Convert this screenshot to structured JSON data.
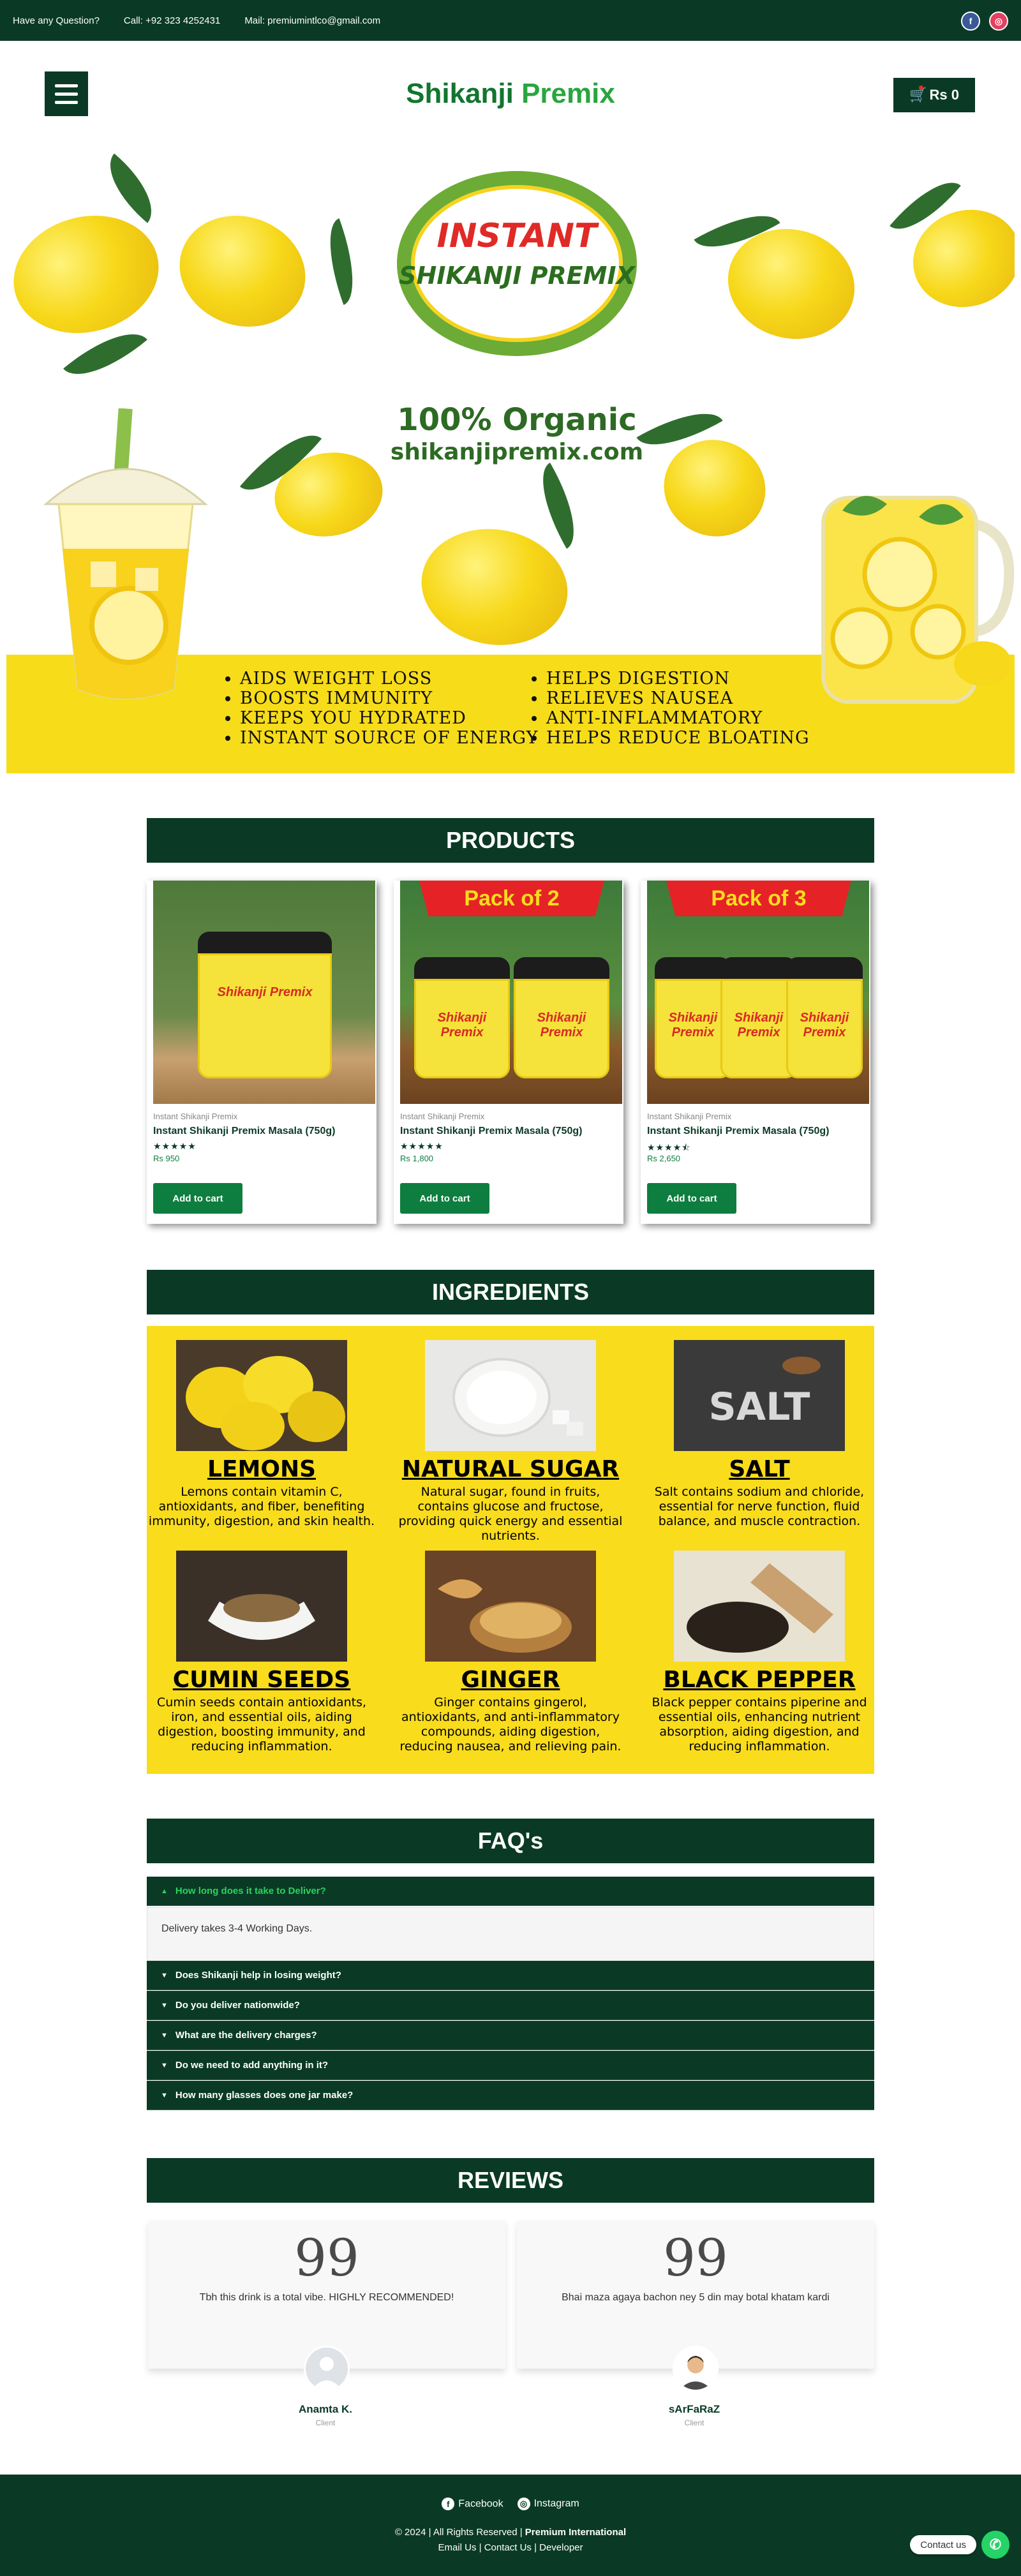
{
  "topbar": {
    "question": "Have any Question?",
    "call": "Call: +92 323 4252431",
    "mail": "Mail:   premiumintlco@gmail.com",
    "facebook_glyph": "f",
    "instagram_glyph": "◎"
  },
  "header": {
    "brand_part1": "Shikanji",
    "brand_part2": " Premix",
    "cart_label": "Rs 0",
    "cart_icon": "🛒"
  },
  "hero": {
    "wreath_line1": "INSTANT",
    "wreath_line2": "SHIKANJI PREMIX",
    "organic": "100% Organic",
    "site": "shikanjipremix.com",
    "benefits_left": [
      "AIDS WEIGHT LOSS",
      "BOOSTS IMMUNITY",
      "KEEPS YOU HYDRATED",
      "INSTANT SOURCE OF ENERGY"
    ],
    "benefits_right": [
      "HELPS DIGESTION",
      "RELIEVES NAUSEA",
      "ANTI-INFLAMMATORY",
      "HELPS REDUCE BLOATING"
    ]
  },
  "products": {
    "heading": "PRODUCTS",
    "items": [
      {
        "category": "Instant Shikanji Premix",
        "title": "Instant Shikanji Premix Masala (750g)",
        "rating": 5,
        "stars": "★★★★★",
        "price": "Rs 950",
        "button": "Add to cart",
        "ribbon": "",
        "jar_label": "Shikanji Premix"
      },
      {
        "category": "Instant Shikanji Premix",
        "title": "Instant Shikanji Premix Masala (750g)",
        "rating": 5,
        "stars": "★★★★★",
        "price": "Rs 1,800",
        "button": "Add to cart",
        "ribbon": "Pack of 2",
        "jar_label": "Shikanji Premix"
      },
      {
        "category": "Instant Shikanji Premix",
        "title": "Instant Shikanji Premix Masala (750g)",
        "rating": 4.5,
        "stars": "★★★★⯪",
        "price": "Rs 2,650",
        "button": "Add to cart",
        "ribbon": "Pack of 3",
        "jar_label": "Shikanji Premix"
      }
    ]
  },
  "ingredients": {
    "heading": "INGREDIENTS",
    "items": [
      {
        "name": "LEMONS",
        "desc": "Lemons contain vitamin C, antioxidants, and fiber, benefiting immunity, digestion, and skin health."
      },
      {
        "name": "NATURAL SUGAR",
        "desc": "Natural sugar, found in fruits, contains glucose and fructose, providing quick energy and essential nutrients."
      },
      {
        "name": "SALT",
        "desc": "Salt contains sodium and chloride, essential for nerve function, fluid balance, and muscle contraction."
      },
      {
        "name": "CUMIN SEEDS",
        "desc": "Cumin seeds contain antioxidants, iron, and essential oils, aiding digestion, boosting immunity, and reducing inflammation."
      },
      {
        "name": "GINGER",
        "desc": "Ginger contains gingerol, antioxidants, and anti-inflammatory compounds, aiding digestion, reducing nausea, and relieving pain."
      },
      {
        "name": "BLACK PEPPER",
        "desc": "Black pepper contains piperine and essential oils, enhancing nutrient absorption, aiding digestion, and reducing inflammation."
      }
    ],
    "salt_pic_text": "SALT"
  },
  "faq": {
    "heading": "FAQ's",
    "items": [
      {
        "q": "How long does it take to Deliver?",
        "open": true,
        "a": "Delivery takes 3-4 Working Days."
      },
      {
        "q": "Does Shikanji help in losing weight?",
        "open": false
      },
      {
        "q": "Do you deliver nationwide?",
        "open": false
      },
      {
        "q": "What are the delivery charges?",
        "open": false
      },
      {
        "q": "Do we need to add anything in it?",
        "open": false
      },
      {
        "q": "How many glasses does one jar make?",
        "open": false
      }
    ],
    "arrow_open": "▲",
    "arrow_closed": "▼"
  },
  "reviews": {
    "heading": "REVIEWS",
    "quote_glyph": "99",
    "items": [
      {
        "text": "Tbh this drink is a total vibe. HIGHLY RECOMMENDED!",
        "name": "Anamta K.",
        "role": "Client"
      },
      {
        "text": "Bhai maza agaya bachon ney 5 din may botal khatam kardi",
        "name": "sArFaRaZ",
        "role": "Client"
      }
    ]
  },
  "footer": {
    "facebook": "Facebook",
    "instagram": "Instagram",
    "fb_glyph": "f",
    "ig_glyph": "◎",
    "copyright": "© 2024 | All Rights Reserved | ",
    "company": "Premium International",
    "links": "Email Us | Contact Us  | Developer",
    "contact_pill": "Contact us",
    "whatsapp_glyph": "✆"
  },
  "colors": {
    "dark_green": "#0a3a25",
    "accent_green": "#0d7e3f",
    "yellow": "#f9dc1c",
    "red": "#e52326"
  }
}
